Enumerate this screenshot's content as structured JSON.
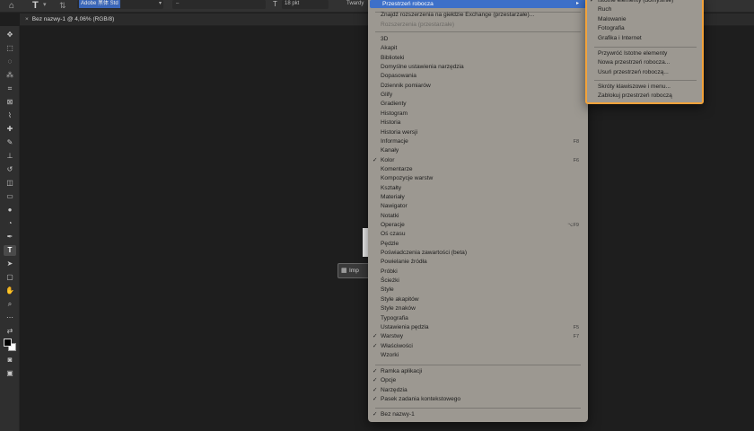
{
  "options_bar": {
    "home_icon": "home-icon",
    "type_tool_glyph": "T",
    "font_family": "Adobe 黑体 Std",
    "font_style": "–",
    "font_size": "18 pkt",
    "antialias": "Twardy"
  },
  "document_tab": {
    "close": "×",
    "title": "Bez nazwy-1 @ 4,06% (RGB/8)"
  },
  "import_button": {
    "label": "Imp"
  },
  "window_menu": {
    "highlighted": "Przestrzeń robocza",
    "extensions": [
      "Znajdź rozszerzenia na giełdzie Exchange (przestarzałe)...",
      "Rozszerzenia (przestarzałe)"
    ],
    "panels": [
      {
        "label": "3D",
        "checked": false,
        "shortcut": ""
      },
      {
        "label": "Akapit",
        "checked": false,
        "shortcut": ""
      },
      {
        "label": "Biblioteki",
        "checked": false,
        "shortcut": ""
      },
      {
        "label": "Domyślne ustawienia narzędzia",
        "checked": false,
        "shortcut": ""
      },
      {
        "label": "Dopasowania",
        "checked": false,
        "shortcut": ""
      },
      {
        "label": "Dziennik pomiarów",
        "checked": false,
        "shortcut": ""
      },
      {
        "label": "Glify",
        "checked": false,
        "shortcut": ""
      },
      {
        "label": "Gradienty",
        "checked": false,
        "shortcut": ""
      },
      {
        "label": "Histogram",
        "checked": false,
        "shortcut": ""
      },
      {
        "label": "Historia",
        "checked": false,
        "shortcut": ""
      },
      {
        "label": "Historia wersji",
        "checked": false,
        "shortcut": ""
      },
      {
        "label": "Informacje",
        "checked": false,
        "shortcut": "F8"
      },
      {
        "label": "Kanały",
        "checked": false,
        "shortcut": ""
      },
      {
        "label": "Kolor",
        "checked": true,
        "shortcut": "F6"
      },
      {
        "label": "Komentarze",
        "checked": false,
        "shortcut": ""
      },
      {
        "label": "Kompozycje warstw",
        "checked": false,
        "shortcut": ""
      },
      {
        "label": "Kształty",
        "checked": false,
        "shortcut": ""
      },
      {
        "label": "Materiały",
        "checked": false,
        "shortcut": ""
      },
      {
        "label": "Nawigator",
        "checked": false,
        "shortcut": ""
      },
      {
        "label": "Notatki",
        "checked": false,
        "shortcut": ""
      },
      {
        "label": "Operacje",
        "checked": false,
        "shortcut": "⌥F9"
      },
      {
        "label": "Oś czasu",
        "checked": false,
        "shortcut": ""
      },
      {
        "label": "Pędzle",
        "checked": false,
        "shortcut": ""
      },
      {
        "label": "Poświadczenia zawartości (beta)",
        "checked": false,
        "shortcut": ""
      },
      {
        "label": "Powielanie źródła",
        "checked": false,
        "shortcut": ""
      },
      {
        "label": "Próbki",
        "checked": false,
        "shortcut": ""
      },
      {
        "label": "Ścieżki",
        "checked": false,
        "shortcut": ""
      },
      {
        "label": "Style",
        "checked": false,
        "shortcut": ""
      },
      {
        "label": "Style akapitów",
        "checked": false,
        "shortcut": ""
      },
      {
        "label": "Style znaków",
        "checked": false,
        "shortcut": ""
      },
      {
        "label": "Typografia",
        "checked": false,
        "shortcut": ""
      },
      {
        "label": "Ustawienia pędzla",
        "checked": false,
        "shortcut": "F5"
      },
      {
        "label": "Warstwy",
        "checked": true,
        "shortcut": "F7"
      },
      {
        "label": "Właściwości",
        "checked": true,
        "shortcut": ""
      },
      {
        "label": "Wzorki",
        "checked": false,
        "shortcut": ""
      }
    ],
    "application": [
      {
        "label": "Ramka aplikacji",
        "checked": true
      },
      {
        "label": "Opcje",
        "checked": true
      },
      {
        "label": "Narzędzia",
        "checked": true
      },
      {
        "label": "Pasek zadania kontekstowego",
        "checked": true
      }
    ],
    "documents": [
      {
        "label": "Bez nazwy-1",
        "checked": true
      }
    ]
  },
  "workspace_submenu": {
    "items": [
      {
        "label": "Istotne elementy (domyślnie)",
        "checked": true
      },
      {
        "label": "Ruch",
        "checked": false
      },
      {
        "label": "Malowanie",
        "checked": false
      },
      {
        "label": "Fotografia",
        "checked": false
      },
      {
        "label": "Grafika i Internet",
        "checked": false
      }
    ],
    "actions": [
      "Przywróć Istotne elementy",
      "Nowa przestrzeń robocza...",
      "Usuń przestrzeń roboczą..."
    ],
    "extra": [
      "Skróty klawiszowe i menu...",
      "Zablokuj przestrzeń roboczą"
    ]
  },
  "colors": {
    "menu_bg": "#9c9891",
    "highlight": "#3d70c9",
    "submenu_border": "#f2a23a",
    "canvas_bg": "#1e1e1e"
  }
}
